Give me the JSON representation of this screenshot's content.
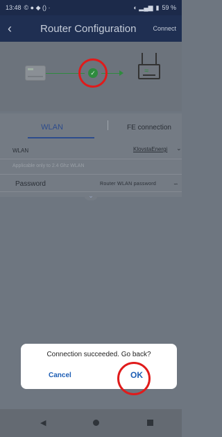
{
  "status_bar": {
    "time": "13:48",
    "left_icons": "© ● ◆ () ·",
    "right_text": "59 %"
  },
  "header": {
    "back_icon": "‹",
    "title": "Router Configuration",
    "connect_label": "Connect"
  },
  "tabs": {
    "wlan_label": "WLAN",
    "fe_label": "FE connection"
  },
  "form": {
    "wlan_label": "WLAN",
    "wlan_value": "KlovstaEnergi",
    "hint": "Applicable only to 2.4 Ghz WLAN",
    "password_label": "Password",
    "password_placeholder": "Router WLAN password"
  },
  "dialog": {
    "message": "Connection succeeded. Go back?",
    "cancel_label": "Cancel",
    "ok_label": "OK"
  },
  "colors": {
    "accent": "#1c5db4",
    "success": "#2e8b3e",
    "highlight_ring": "#e01b1b"
  }
}
